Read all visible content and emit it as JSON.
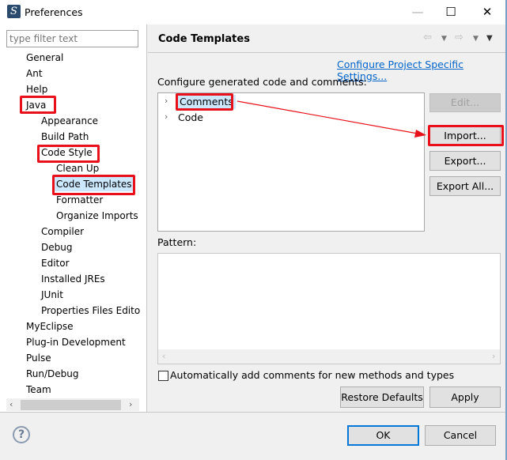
{
  "window": {
    "title": "Preferences",
    "icon": "eclipse-myeclipse-icon",
    "controls": {
      "minimize": "—",
      "maximize": "☐",
      "close": "✕"
    }
  },
  "filter": {
    "placeholder": "type filter text",
    "value": ""
  },
  "tree": [
    {
      "label": "General",
      "level": 0
    },
    {
      "label": "Ant",
      "level": 0
    },
    {
      "label": "Help",
      "level": 0
    },
    {
      "label": "Java",
      "level": 0,
      "highlighted": true
    },
    {
      "label": "Appearance",
      "level": 1
    },
    {
      "label": "Build Path",
      "level": 1
    },
    {
      "label": "Code Style",
      "level": 1,
      "highlighted": true
    },
    {
      "label": "Clean Up",
      "level": 2
    },
    {
      "label": "Code Templates",
      "level": 2,
      "highlighted": true,
      "selected": true
    },
    {
      "label": "Formatter",
      "level": 2
    },
    {
      "label": "Organize Imports",
      "level": 2
    },
    {
      "label": "Compiler",
      "level": 1
    },
    {
      "label": "Debug",
      "level": 1
    },
    {
      "label": "Editor",
      "level": 1
    },
    {
      "label": "Installed JREs",
      "level": 1
    },
    {
      "label": "JUnit",
      "level": 1
    },
    {
      "label": "Properties Files Edito",
      "level": 1
    },
    {
      "label": "MyEclipse",
      "level": 0
    },
    {
      "label": "Plug-in Development",
      "level": 0
    },
    {
      "label": "Pulse",
      "level": 0
    },
    {
      "label": "Run/Debug",
      "level": 0
    },
    {
      "label": "Team",
      "level": 0
    }
  ],
  "page": {
    "title": "Code Templates",
    "link": "Configure Project Specific Settings...",
    "configure_label": "Configure generated code and comments:",
    "templates": [
      {
        "label": "Comments",
        "selected": true
      },
      {
        "label": "Code",
        "selected": false
      }
    ],
    "buttons": {
      "edit": "Edit...",
      "import": "Import...",
      "export": "Export...",
      "export_all": "Export All..."
    },
    "pattern_label": "Pattern:",
    "auto_comments": {
      "label": "Automatically add comments for new methods and types",
      "checked": false
    },
    "restore_defaults": "Restore Defaults",
    "apply": "Apply"
  },
  "footer": {
    "ok": "OK",
    "cancel": "Cancel"
  },
  "colors": {
    "annotation_red": "#e8101a",
    "link": "#0064c8",
    "selection": "#cce8ff"
  }
}
